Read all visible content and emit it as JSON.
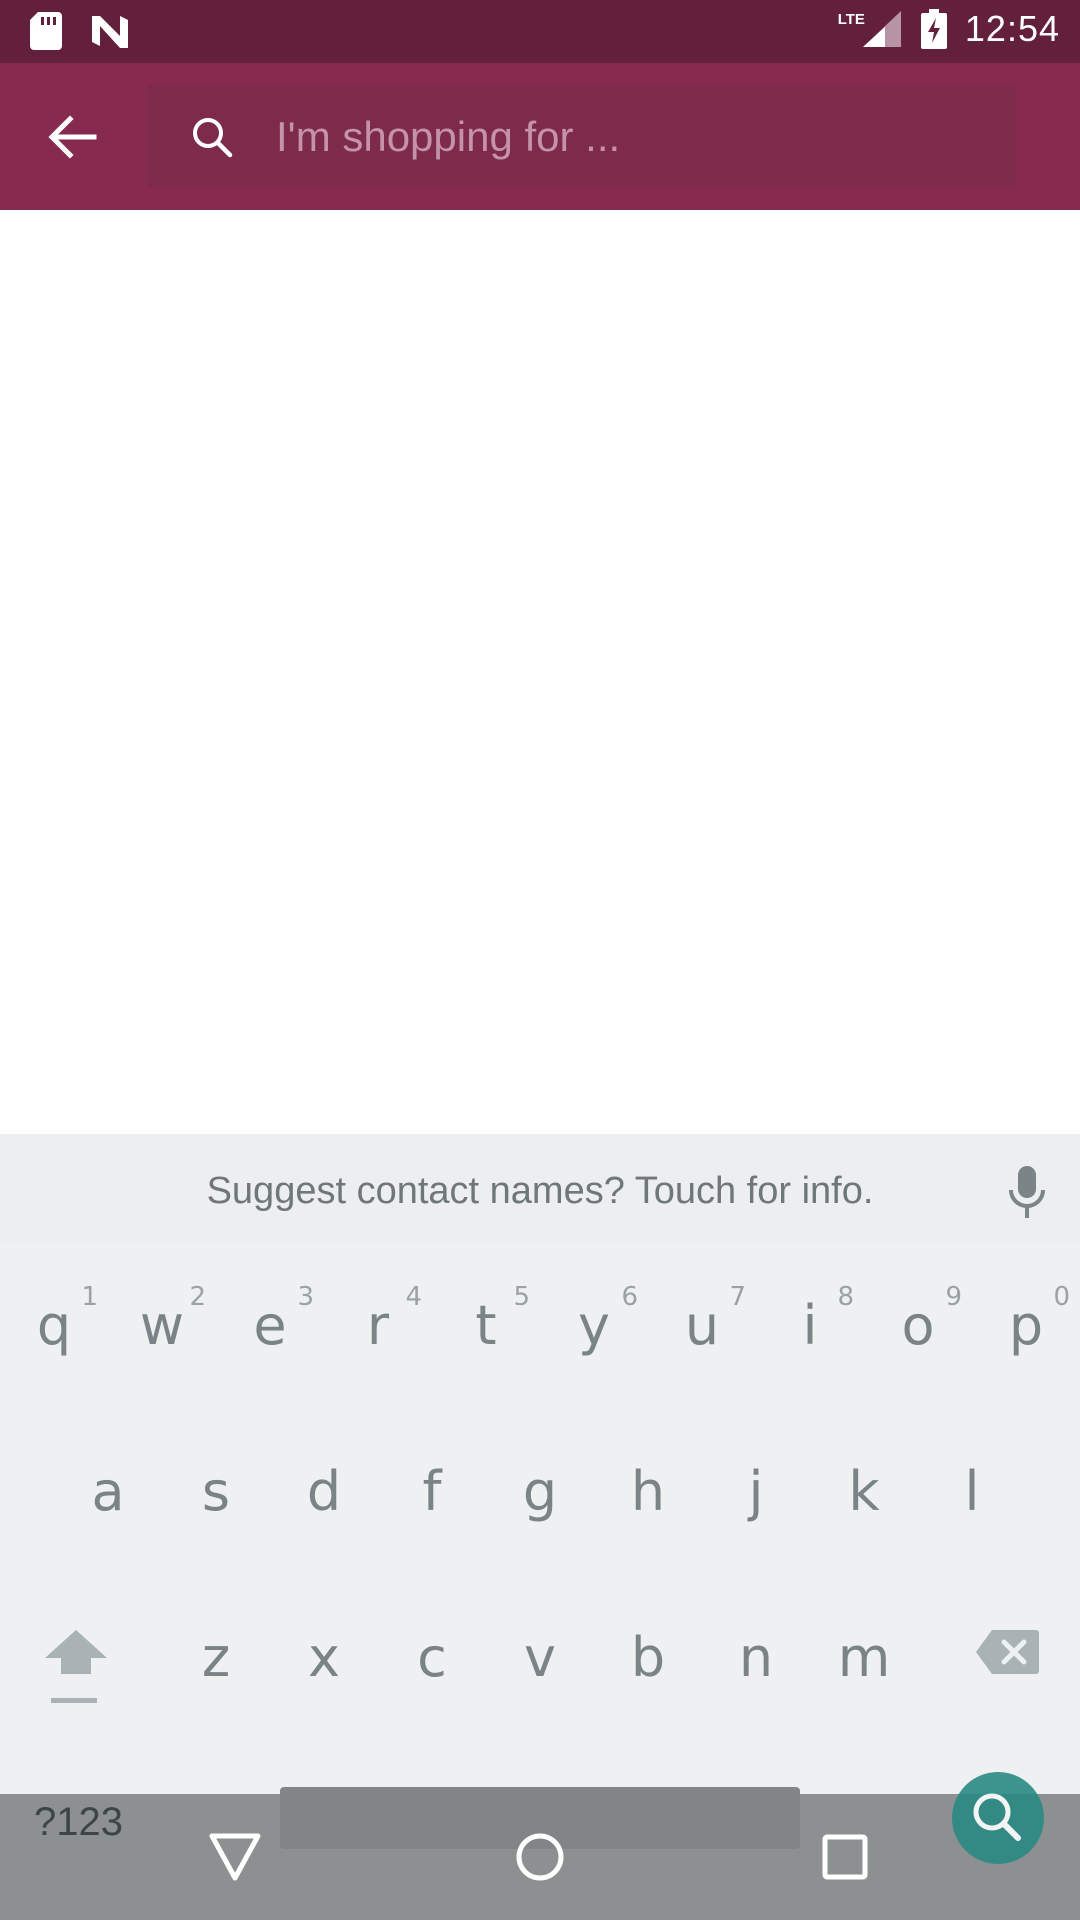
{
  "status_bar": {
    "time": "12:54",
    "network": "LTE",
    "icons": [
      "sd-card-icon",
      "n-logo-icon",
      "signal-icon",
      "battery-charging-icon"
    ]
  },
  "app_bar": {
    "back_icon": "arrow-left-icon",
    "search_icon": "search-icon",
    "search_placeholder": "I'm shopping for ...",
    "search_value": "",
    "colors": {
      "status": "#63203d",
      "bar": "#862b4f",
      "field": "#7d2a4b"
    }
  },
  "keyboard": {
    "suggestion": "Suggest contact names? Touch for info.",
    "row1": [
      {
        "letter": "q",
        "num": "1"
      },
      {
        "letter": "w",
        "num": "2"
      },
      {
        "letter": "e",
        "num": "3"
      },
      {
        "letter": "r",
        "num": "4"
      },
      {
        "letter": "t",
        "num": "5"
      },
      {
        "letter": "y",
        "num": "6"
      },
      {
        "letter": "u",
        "num": "7"
      },
      {
        "letter": "i",
        "num": "8"
      },
      {
        "letter": "o",
        "num": "9"
      },
      {
        "letter": "p",
        "num": "0"
      }
    ],
    "row2": [
      "a",
      "s",
      "d",
      "f",
      "g",
      "h",
      "j",
      "k",
      "l"
    ],
    "row3": [
      "z",
      "x",
      "c",
      "v",
      "b",
      "n",
      "m"
    ],
    "symbols_label": "?123"
  },
  "nav_bar": {
    "icons": [
      "back-triangle-icon",
      "home-circle-icon",
      "recents-square-icon"
    ]
  }
}
